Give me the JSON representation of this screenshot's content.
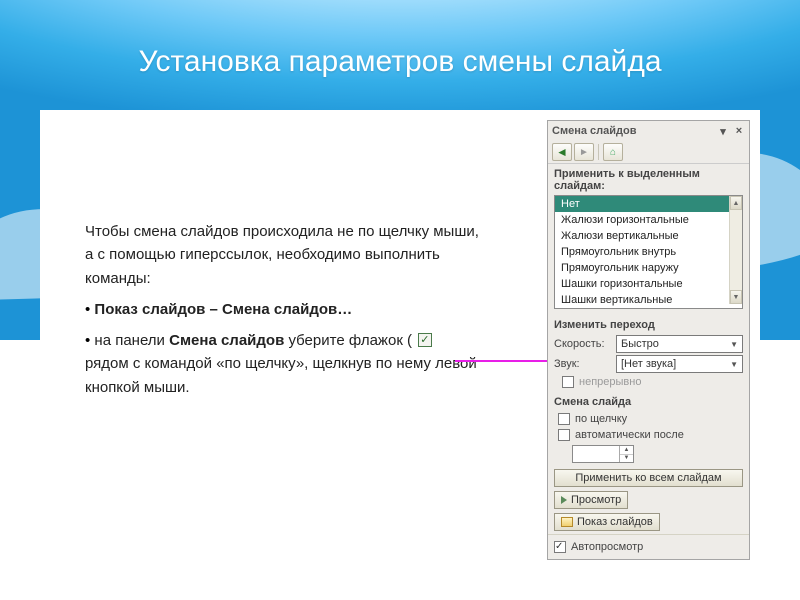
{
  "title": "Установка параметров смены слайда",
  "body": {
    "p1": "Чтобы смена слайдов происходила не по щелчку мыши, а с помощью гиперссылок, необходимо выполнить команды:",
    "b1_strong": "Показ слайдов – Смена слайдов…",
    "b2_pre": "на панели ",
    "b2_strong": "Смена слайдов",
    "b2_mid": " уберите флажок ( ",
    "b2_post": " рядом с командой «по щелчку», щелкнув по нему левой кнопкой мыши."
  },
  "pane": {
    "title": "Смена слайдов",
    "apply_label": "Применить к выделенным слайдам:",
    "transitions": [
      "Нет",
      "Жалюзи горизонтальные",
      "Жалюзи вертикальные",
      "Прямоугольник внутрь",
      "Прямоугольник наружу",
      "Шашки горизонтальные",
      "Шашки вертикальные"
    ],
    "modify_header": "Изменить переход",
    "speed_label": "Скорость:",
    "speed_value": "Быстро",
    "sound_label": "Звук:",
    "sound_value": "[Нет звука]",
    "loop_label": "непрерывно",
    "advance_header": "Смена слайда",
    "on_click_label": "по щелчку",
    "auto_after_label": "автоматически после",
    "apply_all": "Применить ко всем слайдам",
    "play": "Просмотр",
    "slideshow": "Показ слайдов",
    "autopreview": "Автопросмотр"
  }
}
